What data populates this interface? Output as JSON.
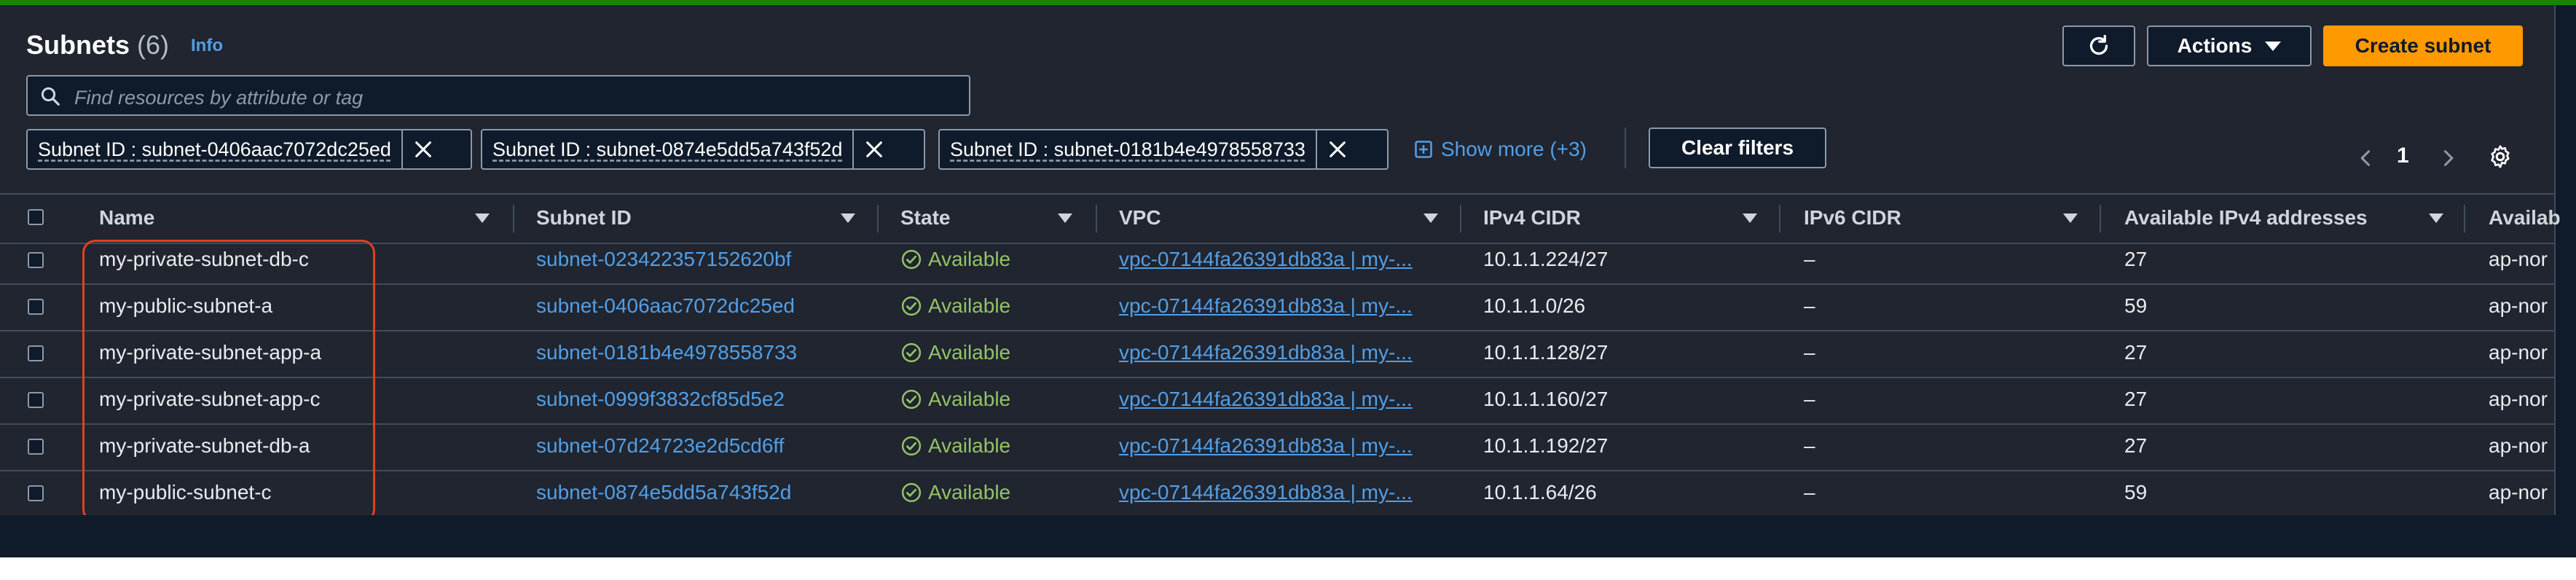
{
  "header": {
    "title": "Subnets",
    "count": "(6)",
    "info_label": "Info",
    "actions_label": "Actions",
    "create_label": "Create subnet"
  },
  "search": {
    "placeholder": "Find resources by attribute or tag"
  },
  "filters": {
    "tokens": [
      "Subnet ID : subnet-0406aac7072dc25ed",
      "Subnet ID : subnet-0874e5dd5a743f52d",
      "Subnet ID : subnet-0181b4e4978558733"
    ],
    "show_more": "Show more (+3)",
    "clear_label": "Clear filters"
  },
  "pagination": {
    "page": "1"
  },
  "table": {
    "columns": [
      "Name",
      "Subnet ID",
      "State",
      "VPC",
      "IPv4 CIDR",
      "IPv6 CIDR",
      "Available IPv4 addresses",
      "Availab"
    ],
    "rows": [
      {
        "name": "my-private-subnet-db-c",
        "subnet_id": "subnet-023422357152620bf",
        "state": "Available",
        "vpc": "vpc-07144fa26391db83a | my-...",
        "ipv4": "10.1.1.224/27",
        "ipv6": "–",
        "avail": "27",
        "az": "ap-nor"
      },
      {
        "name": "my-public-subnet-a",
        "subnet_id": "subnet-0406aac7072dc25ed",
        "state": "Available",
        "vpc": "vpc-07144fa26391db83a | my-...",
        "ipv4": "10.1.1.0/26",
        "ipv6": "–",
        "avail": "59",
        "az": "ap-nor"
      },
      {
        "name": "my-private-subnet-app-a",
        "subnet_id": "subnet-0181b4e4978558733",
        "state": "Available",
        "vpc": "vpc-07144fa26391db83a | my-...",
        "ipv4": "10.1.1.128/27",
        "ipv6": "–",
        "avail": "27",
        "az": "ap-nor"
      },
      {
        "name": "my-private-subnet-app-c",
        "subnet_id": "subnet-0999f3832cf85d5e2",
        "state": "Available",
        "vpc": "vpc-07144fa26391db83a | my-...",
        "ipv4": "10.1.1.160/27",
        "ipv6": "–",
        "avail": "27",
        "az": "ap-nor"
      },
      {
        "name": "my-private-subnet-db-a",
        "subnet_id": "subnet-07d24723e2d5cd6ff",
        "state": "Available",
        "vpc": "vpc-07144fa26391db83a | my-...",
        "ipv4": "10.1.1.192/27",
        "ipv6": "–",
        "avail": "27",
        "az": "ap-nor"
      },
      {
        "name": "my-public-subnet-c",
        "subnet_id": "subnet-0874e5dd5a743f52d",
        "state": "Available",
        "vpc": "vpc-07144fa26391db83a | my-...",
        "ipv4": "10.1.1.64/26",
        "ipv6": "–",
        "avail": "59",
        "az": "ap-nor"
      }
    ]
  },
  "colors": {
    "accent_orange": "#ff9900",
    "link_blue": "#539fe5",
    "available_green": "#94c266",
    "highlight_red": "#e0401f",
    "top_bar_green": "#1d8102"
  },
  "icons": [
    "refresh-icon",
    "caret-down-icon",
    "search-icon",
    "close-icon",
    "expand-icon",
    "chevron-left-icon",
    "chevron-right-icon",
    "gear-icon",
    "sort-icon",
    "check-circle-icon"
  ]
}
